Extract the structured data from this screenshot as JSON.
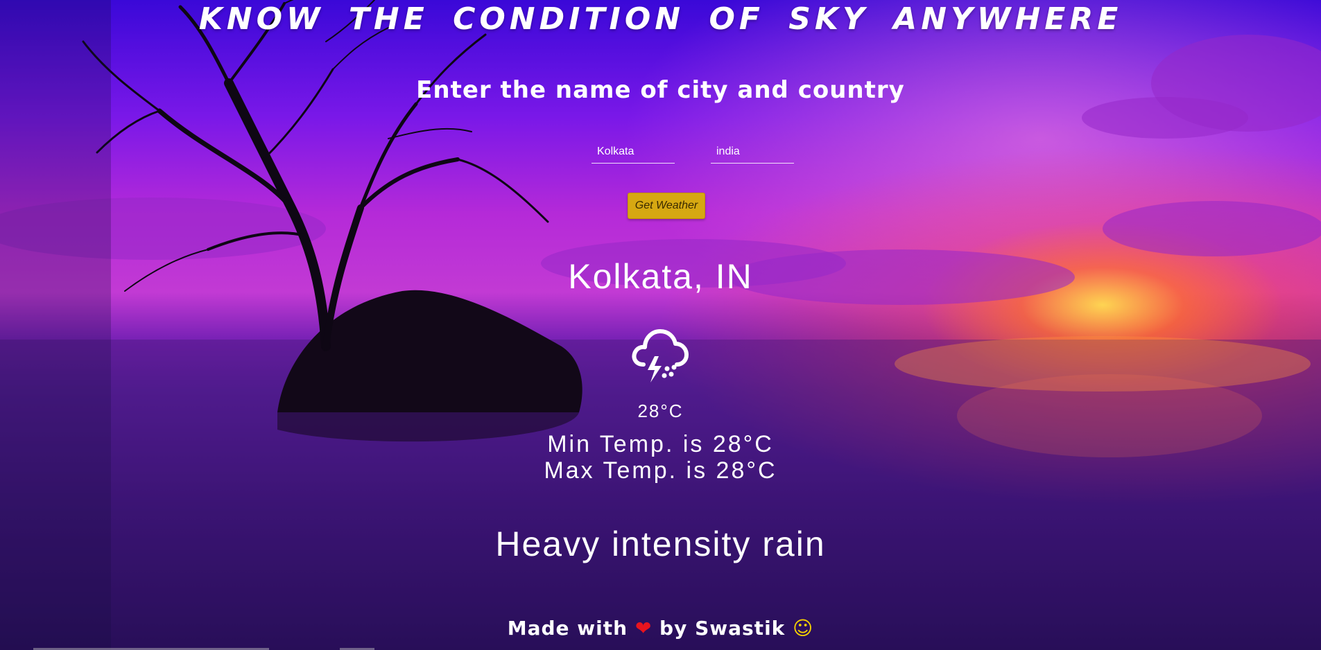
{
  "header": {
    "title": "KNOW THE CONDITION OF SKY ANYWHERE",
    "subtitle": "Enter the name of city and country"
  },
  "form": {
    "city_value": "Kolkata",
    "country_value": "india",
    "submit_label": "Get Weather"
  },
  "result": {
    "location": "Kolkata, IN",
    "icon": "thunderstorm-rain-icon",
    "temperature": "28°C",
    "min_temp": "Min Temp. is 28°C",
    "max_temp": "Max Temp. is 28°C",
    "description": "Heavy intensity rain"
  },
  "footer": {
    "made_with": "Made with",
    "heart": "❤",
    "by": "by Swastik",
    "smile": "☺"
  },
  "colors": {
    "button_bg": "#d6a812",
    "heart": "#e8141e",
    "smile": "#f4d000"
  }
}
